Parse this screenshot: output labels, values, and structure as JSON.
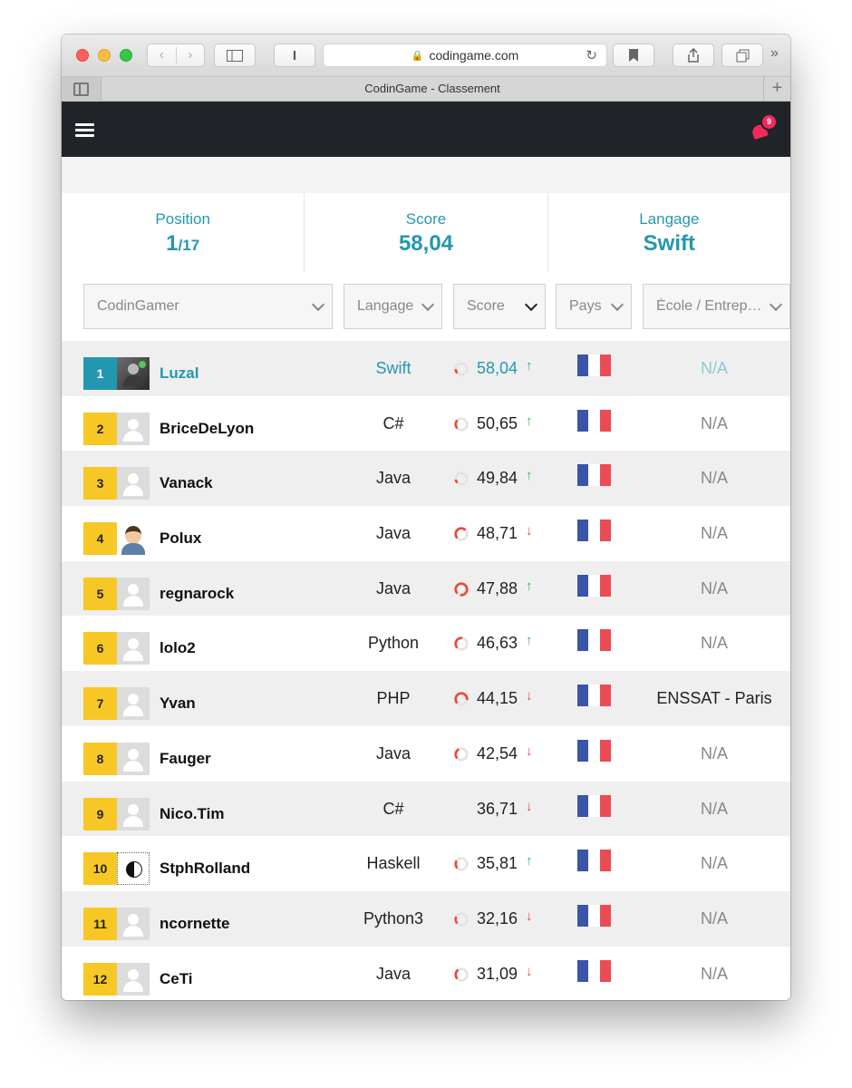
{
  "browser": {
    "url": "codingame.com",
    "tab_title": "CodinGame - Classement"
  },
  "header": {
    "notification_count": "9"
  },
  "stats": {
    "position_label": "Position",
    "position_value": "1",
    "position_total": "/17",
    "score_label": "Score",
    "score_value": "58,04",
    "language_label": "Langage",
    "language_value": "Swift"
  },
  "filters": {
    "codingamer": "CodinGamer",
    "language": "Langage",
    "score": "Score",
    "country": "Pays",
    "school": "École / Entreprise"
  },
  "colors": {
    "accent": "#2497b0",
    "rank_badge": "#f7c825",
    "gauge": "#e74c3c",
    "trend_up": "#3cb553",
    "trend_down": "#e74c3c",
    "header_bg": "#212529",
    "notification": "#f2295b"
  },
  "rows": [
    {
      "rank": "1",
      "name": "Luzal",
      "language": "Swift",
      "score": "58,04",
      "gauge": 0.12,
      "trend": "up",
      "trend_icon": "arrow-up-icon",
      "country": "France",
      "school": "N/A",
      "avatar": "photo",
      "me": true
    },
    {
      "rank": "2",
      "name": "BriceDeLyon",
      "language": "C#",
      "score": "50,65",
      "gauge": 0.25,
      "trend": "up",
      "trend_icon": "arrow-up-icon",
      "country": "France",
      "school": "N/A",
      "avatar": "default"
    },
    {
      "rank": "3",
      "name": "Vanack",
      "language": "Java",
      "score": "49,84",
      "gauge": 0.1,
      "trend": "up",
      "trend_icon": "arrow-up-icon",
      "country": "France",
      "school": "N/A",
      "avatar": "default"
    },
    {
      "rank": "4",
      "name": "Polux",
      "language": "Java",
      "score": "48,71",
      "gauge": 0.5,
      "trend": "down",
      "trend_icon": "arrow-down-icon",
      "country": "France",
      "school": "N/A",
      "avatar": "cartoon"
    },
    {
      "rank": "5",
      "name": "regnarock",
      "language": "Java",
      "score": "47,88",
      "gauge": 0.9,
      "trend": "up",
      "trend_icon": "arrow-up-icon",
      "country": "France",
      "school": "N/A",
      "avatar": "default"
    },
    {
      "rank": "6",
      "name": "lolo2",
      "language": "Python",
      "score": "46,63",
      "gauge": 0.4,
      "trend": "up",
      "trend_icon": "arrow-up-icon",
      "country": "France",
      "school": "N/A",
      "avatar": "default"
    },
    {
      "rank": "7",
      "name": "Yvan",
      "language": "PHP",
      "score": "44,15",
      "gauge": 0.65,
      "trend": "down",
      "trend_icon": "arrow-down-icon",
      "country": "France",
      "school": "ENSSAT - Paris",
      "avatar": "default"
    },
    {
      "rank": "8",
      "name": "Fauger",
      "language": "Java",
      "score": "42,54",
      "gauge": 0.3,
      "trend": "down",
      "trend_icon": "arrow-down-icon",
      "country": "France",
      "school": "N/A",
      "avatar": "default"
    },
    {
      "rank": "9",
      "name": "Nico.Tim",
      "language": "C#",
      "score": "36,71",
      "gauge": 0,
      "trend": "down",
      "trend_icon": "arrow-down-icon",
      "country": "France",
      "school": "N/A",
      "avatar": "default"
    },
    {
      "rank": "10",
      "name": "StphRolland",
      "language": "Haskell",
      "score": "35,81",
      "gauge": 0.22,
      "trend": "up",
      "trend_icon": "arrow-up-icon",
      "country": "France",
      "school": "N/A",
      "avatar": "yin"
    },
    {
      "rank": "11",
      "name": "ncornette",
      "language": "Python3",
      "score": "32,16",
      "gauge": 0.2,
      "trend": "down",
      "trend_icon": "arrow-down-icon",
      "country": "France",
      "school": "N/A",
      "avatar": "default"
    },
    {
      "rank": "12",
      "name": "CeTi",
      "language": "Java",
      "score": "31,09",
      "gauge": 0.28,
      "trend": "down",
      "trend_icon": "arrow-down-icon",
      "country": "France",
      "school": "N/A",
      "avatar": "default"
    }
  ]
}
